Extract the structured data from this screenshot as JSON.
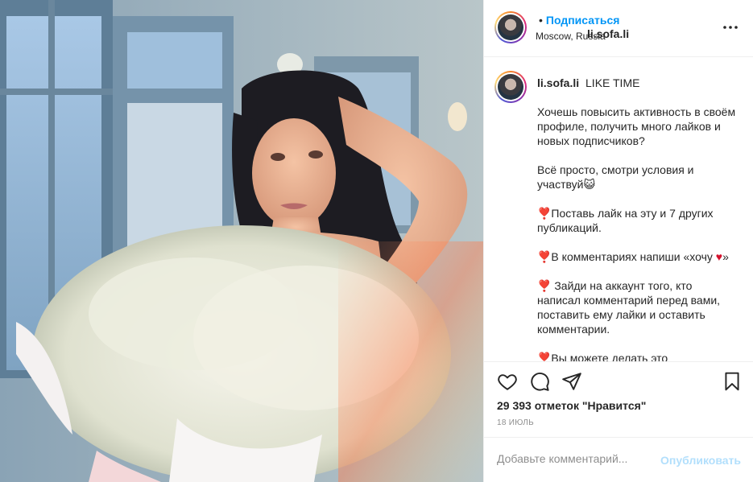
{
  "post": {
    "username": "li.sofa.li",
    "separator": "•",
    "follow_label": "Подписаться",
    "location": "Moscow, Russia",
    "more_label": "•••"
  },
  "caption": {
    "username": "li.sofa.li",
    "title": "LIKE TIME",
    "paragraphs": [
      "Хочешь повысить активность в своём профиле, получить много лайков и новых подписчиков?",
      "Всё просто, смотри условия и участвуй😺",
      "❣️Поставь лайк на эту и 7 других публикаций.",
      "❣️В комментариях напиши «хочу ",
      "❣️ Зайди на аккаунт того, кто написал комментарий перед вами, поставить ему лайки и оставить комментарии.",
      "❣️Вы можете делать это"
    ],
    "heart_suffix": "♥",
    "quote_close": "»"
  },
  "actions": {
    "like_icon": "heart-outline-icon",
    "comment_icon": "comment-icon",
    "share_icon": "paper-plane-icon",
    "save_icon": "bookmark-icon"
  },
  "likes_text": "29 393 отметок \"Нравится\"",
  "date": "18 ИЮЛЬ",
  "comment": {
    "placeholder": "Добавьте комментарий...",
    "publish_label": "Опубликовать"
  }
}
